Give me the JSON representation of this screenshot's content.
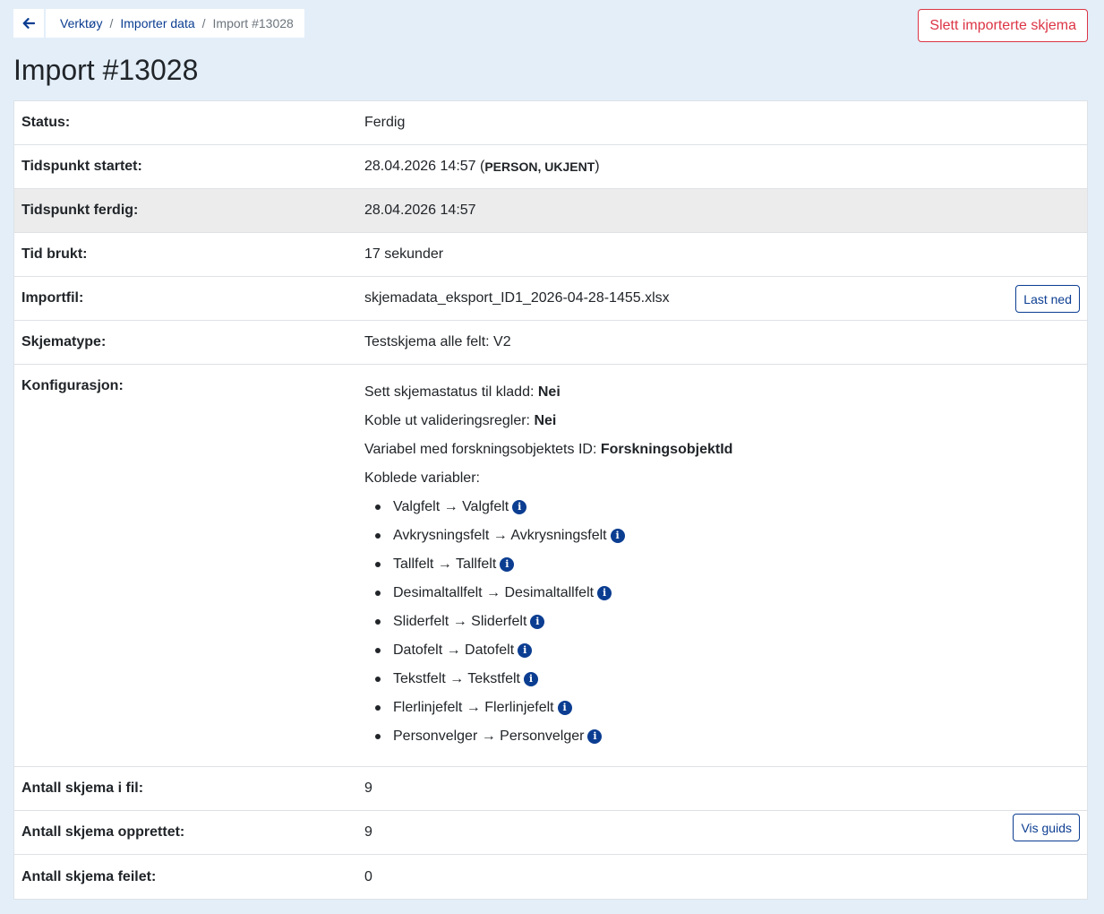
{
  "breadcrumb": {
    "items": [
      "Verktøy",
      "Importer data"
    ],
    "current": "Import #13028",
    "separator": "/"
  },
  "actions": {
    "delete_label": "Slett importerte skjema"
  },
  "page": {
    "title": "Import #13028"
  },
  "details": {
    "status": {
      "label": "Status:",
      "value": "Ferdig"
    },
    "started": {
      "label": "Tidspunkt startet:",
      "value": "28.04.2026 14:57",
      "open_paren": "(",
      "person": "PERSON, UKJENT",
      "close_paren": ")"
    },
    "finished": {
      "label": "Tidspunkt ferdig:",
      "value": "28.04.2026 14:57"
    },
    "duration": {
      "label": "Tid brukt:",
      "value": "17 sekunder"
    },
    "file": {
      "label": "Importfil:",
      "value": "skjemadata_eksport_ID1_2026-04-28-1455.xlsx",
      "button": "Last ned"
    },
    "form_type": {
      "label": "Skjematype:",
      "value": "Testskjema alle felt: V2"
    },
    "config": {
      "label": "Konfigurasjon:",
      "draft_label": "Sett skjemastatus til kladd:",
      "draft_value": "Nei",
      "validation_label": "Koble ut valideringsregler:",
      "validation_value": "Nei",
      "id_var_label": "Variabel med forskningsobjektets ID:",
      "id_var_value": "ForskningsobjektId",
      "linked_label": "Koblede variabler:",
      "mappings": [
        "Valgfelt → Valgfelt",
        "Avkrysningsfelt → Avkrysningsfelt",
        "Tallfelt → Tallfelt",
        "Desimaltallfelt → Desimaltallfelt",
        "Sliderfelt → Sliderfelt",
        "Datofelt → Datofelt",
        "Tekstfelt → Tekstfelt",
        "Flerlinjefelt → Flerlinjefelt",
        "Personvelger → Personvelger"
      ]
    },
    "count_file": {
      "label": "Antall skjema i fil:",
      "value": "9"
    },
    "count_created": {
      "label": "Antall skjema opprettet:",
      "value": "9",
      "button": "Vis guids"
    },
    "count_failed": {
      "label": "Antall skjema feilet:",
      "value": "0"
    }
  },
  "icons": {
    "back": "arrow-left-icon",
    "info": "info-circle-icon"
  },
  "colors": {
    "background": "#e3eef8",
    "primary": "#0b3d91",
    "danger": "#dc3545",
    "shaded_row": "#ececec"
  }
}
